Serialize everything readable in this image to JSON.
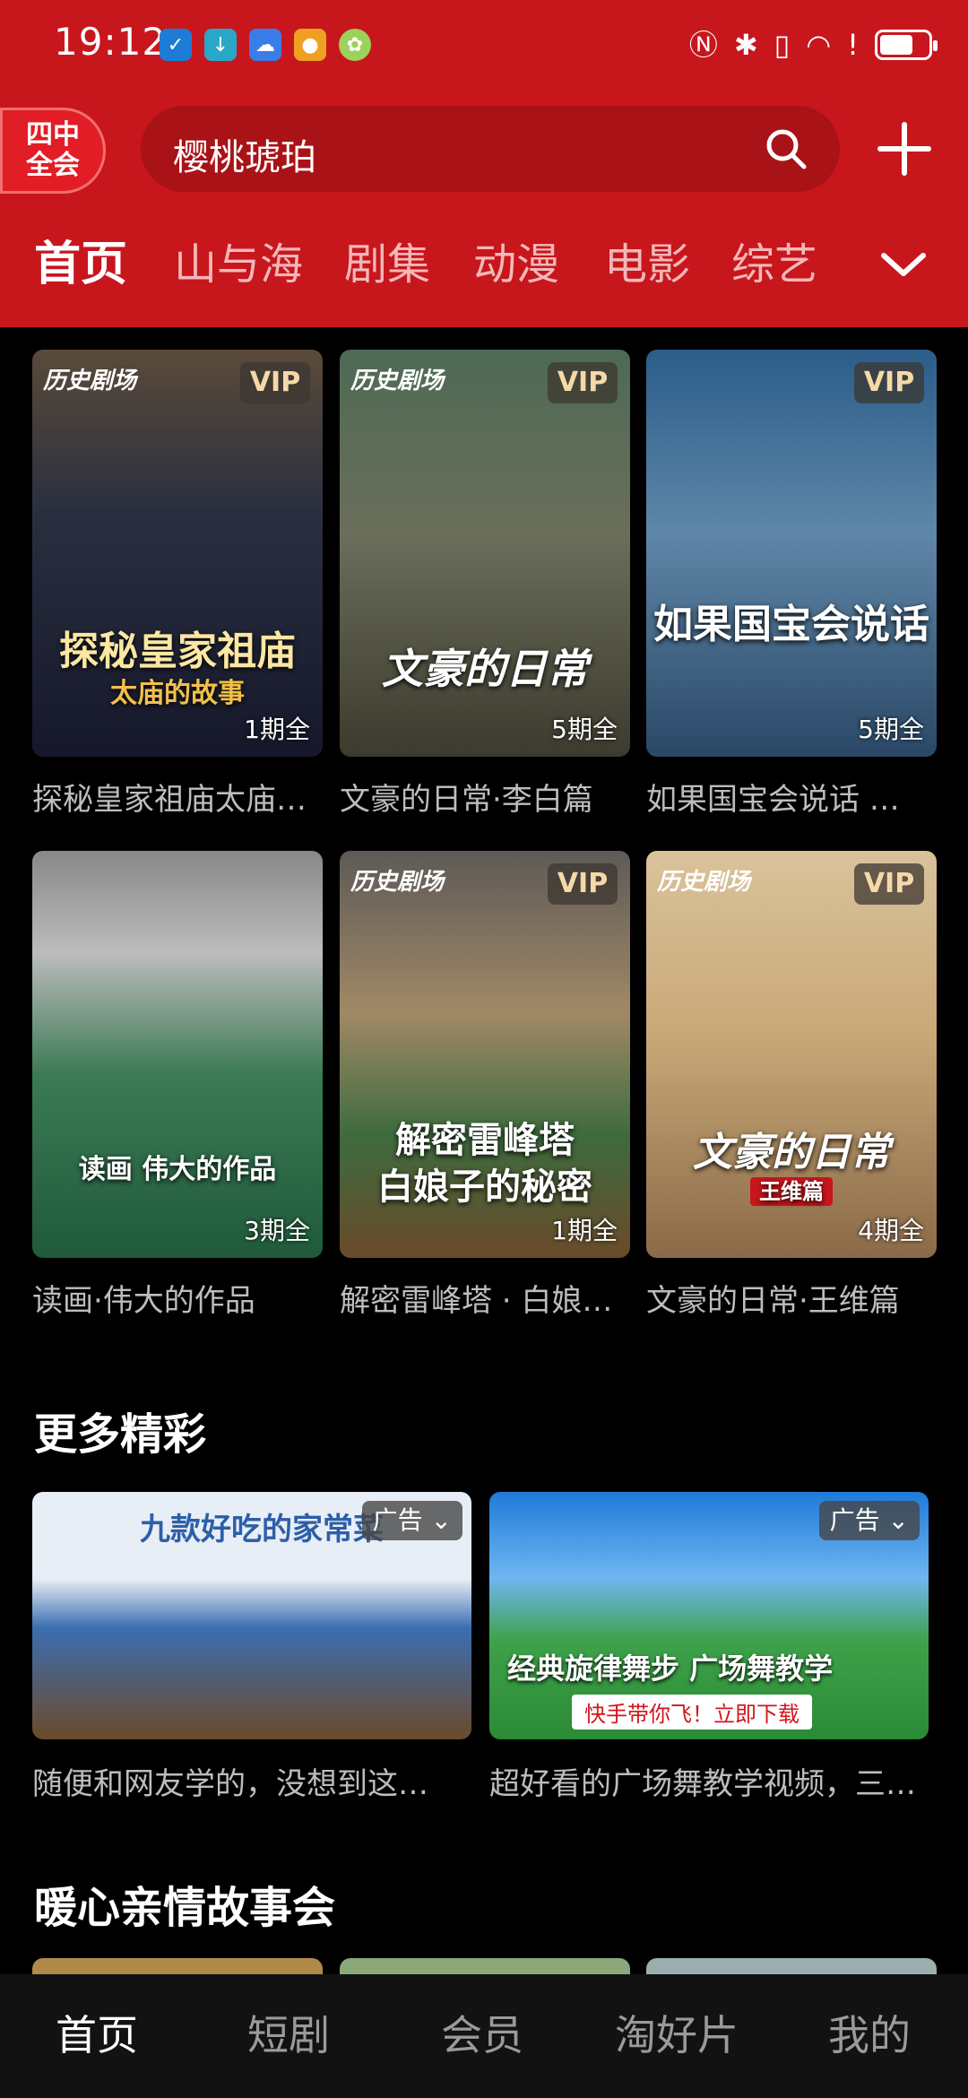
{
  "status_bar": {
    "time": "19:12"
  },
  "header": {
    "badge_line1": "四中",
    "badge_line2": "全会",
    "search_text": "樱桃琥珀",
    "tabs": [
      "首页",
      "山与海",
      "剧集",
      "动漫",
      "电影",
      "综艺"
    ],
    "active_tab": 0
  },
  "grid": [
    {
      "title": "探秘皇家祖庙太庙…",
      "episodes": "1期全",
      "vip": "VIP",
      "brand": "历史剧场",
      "poster_title": "探秘皇家祖庙",
      "poster_sub": "太庙的故事"
    },
    {
      "title": "文豪的日常·李白篇",
      "episodes": "5期全",
      "vip": "VIP",
      "brand": "历史剧场",
      "poster_title": "文豪的日常"
    },
    {
      "title": "如果国宝会说话 …",
      "episodes": "5期全",
      "vip": "VIP",
      "poster_title": "如果国宝会说话"
    },
    {
      "title": "读画·伟大的作品",
      "episodes": "3期全",
      "poster_title": "读画 伟大的作品"
    },
    {
      "title": "解密雷峰塔 · 白娘…",
      "episodes": "1期全",
      "vip": "VIP",
      "brand": "历史剧场",
      "poster_title": "解密雷峰塔",
      "poster_sub": "白娘子的秘密"
    },
    {
      "title": "文豪的日常·王维篇",
      "episodes": "4期全",
      "vip": "VIP",
      "brand": "历史剧场",
      "poster_title": "文豪的日常",
      "poster_sub": "王维篇"
    }
  ],
  "sections": {
    "more": "更多精彩",
    "family": "暖心亲情故事会"
  },
  "ads": [
    {
      "title": "随便和网友学的，没想到这…",
      "badge": "广告",
      "headline": "九款好吃的家常菜"
    },
    {
      "title": "超好看的广场舞教学视频，三…",
      "badge": "广告",
      "headline": "经典旋律舞步 广场舞教学",
      "cta": "快手带你飞！立即下载"
    }
  ],
  "bottom_nav": [
    "首页",
    "短剧",
    "会员",
    "淘好片",
    "我的"
  ],
  "active_nav": 0
}
